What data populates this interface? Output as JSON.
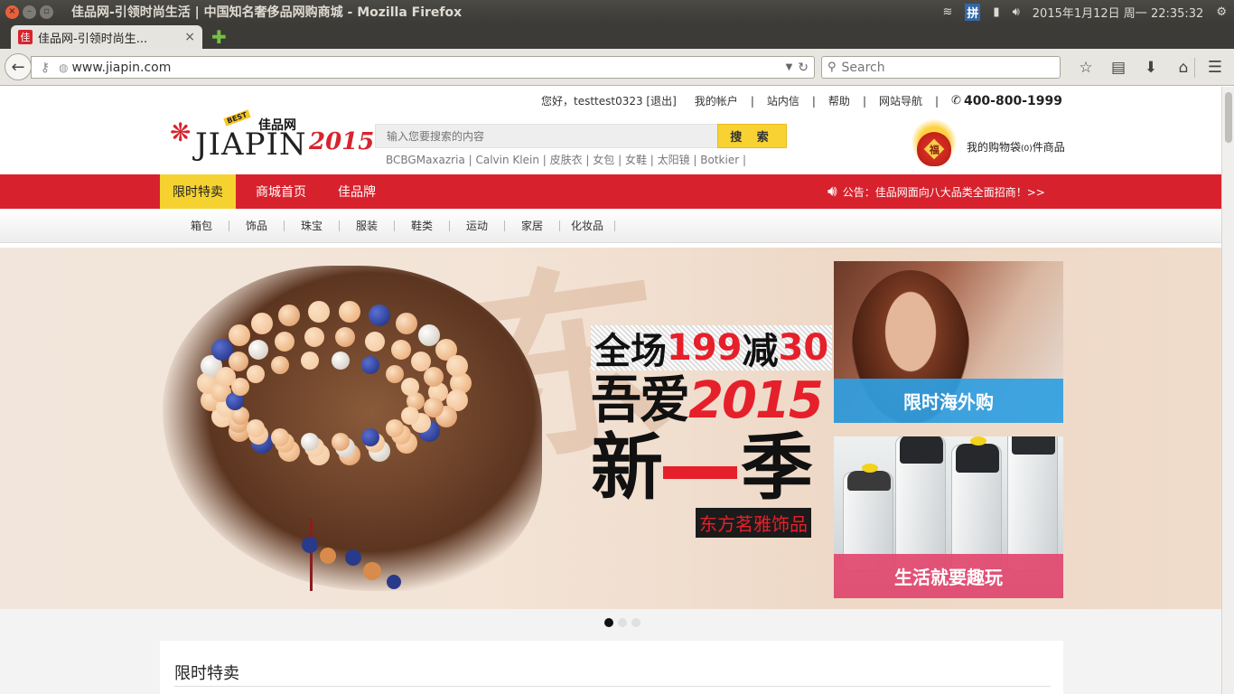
{
  "os": {
    "window_title": "佳品网-引领时尚生活 | 中国知名奢侈品网购商城 - Mozilla Firefox",
    "input_method": "拼",
    "datetime": "2015年1月12日 周一 22:35:32"
  },
  "browser": {
    "tab_title": "佳品网-引领时尚生...",
    "tab_favicon_char": "佳",
    "url": "www.jiapin.com",
    "search_placeholder": "Search"
  },
  "site": {
    "top_links": {
      "greeting": "您好，testtest0323 [退出]",
      "account": "我的帐户",
      "messages": "站内信",
      "help": "帮助",
      "site_nav": "网站导航",
      "phone": "400-800-1999"
    },
    "logo": {
      "brand": "JIAPIN",
      "brand_cn": "佳品网",
      "badge": "BEST",
      "year": "2015"
    },
    "search": {
      "placeholder": "输入您要搜索的内容",
      "button": "搜 索",
      "hotwords": "BCBGMaxazria | Calvin Klein | 皮肤衣 | 女包 | 女鞋 | 太阳镜 | Botkier |"
    },
    "cart": {
      "prefix": "我的购物袋",
      "count": "(0)",
      "suffix": "件商品",
      "bag_char": "福"
    },
    "main_nav": [
      "限时特卖",
      "商城首页",
      "佳品牌"
    ],
    "notice": "公告：佳品网面向八大品类全面招商！>>",
    "sub_nav": [
      "箱包",
      "饰品",
      "珠宝",
      "服装",
      "鞋类",
      "运动",
      "家居",
      "化妆品"
    ],
    "banner": {
      "brush_char": "东",
      "line1_a": "全场",
      "line1_b": "199",
      "line1_c": "减",
      "line1_d": "30",
      "line2_a": "吾爱",
      "line2_b": "2015",
      "line3_a": "新",
      "line3_b": "季",
      "line4": "东方茗雅饰品"
    },
    "side_cards": [
      "限时海外购",
      "生活就要趣玩"
    ],
    "section_title": "限时特卖"
  }
}
